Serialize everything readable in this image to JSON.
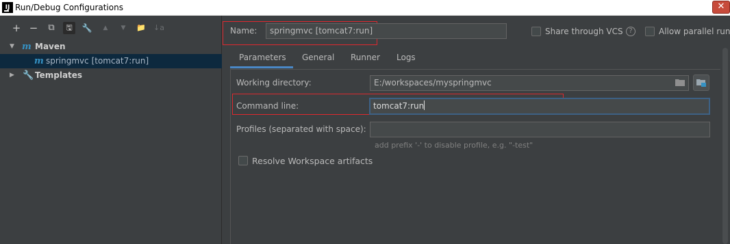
{
  "window": {
    "app_icon_text": "IJ",
    "title": "Run/Debug Configurations",
    "close_symbol": "✕"
  },
  "toolbar": {
    "add": "+",
    "remove": "−",
    "copy": "⧉",
    "save": "🖫",
    "edit_defaults": "🔧",
    "move_up": "▲",
    "move_down": "▼",
    "new_folder": "📁",
    "sort": "↓a"
  },
  "tree": {
    "maven": {
      "arrow": "▼",
      "icon": "m",
      "label": "Maven"
    },
    "springmvc": {
      "icon": "m",
      "label": "springmvc [tomcat7:run]"
    },
    "templates": {
      "arrow": "▶",
      "label": "Templates"
    }
  },
  "header": {
    "name_label": "Name:",
    "name_value": "springmvc [tomcat7:run]",
    "share_label": "Share through VCS",
    "help_symbol": "?",
    "parallel_label": "Allow parallel run"
  },
  "tabs": [
    {
      "label": "Parameters"
    },
    {
      "label": "General"
    },
    {
      "label": "Runner"
    },
    {
      "label": "Logs"
    }
  ],
  "parameters": {
    "working_dir_label": "Working directory:",
    "working_dir_value": "E:/workspaces/myspringmvc",
    "command_line_label": "Command line:",
    "command_line_value": "tomcat7:run",
    "profiles_label": "Profiles (separated with space):",
    "profiles_value": "",
    "profiles_hint": "add prefix '-' to disable profile, e.g. \"-test\"",
    "resolve_label": "Resolve Workspace artifacts"
  },
  "colors": {
    "background": "#3c3f41",
    "selection": "#0d293e",
    "accent": "#4a88c7",
    "highlight_box": "#e0282e",
    "maven_icon": "#3592c4"
  }
}
